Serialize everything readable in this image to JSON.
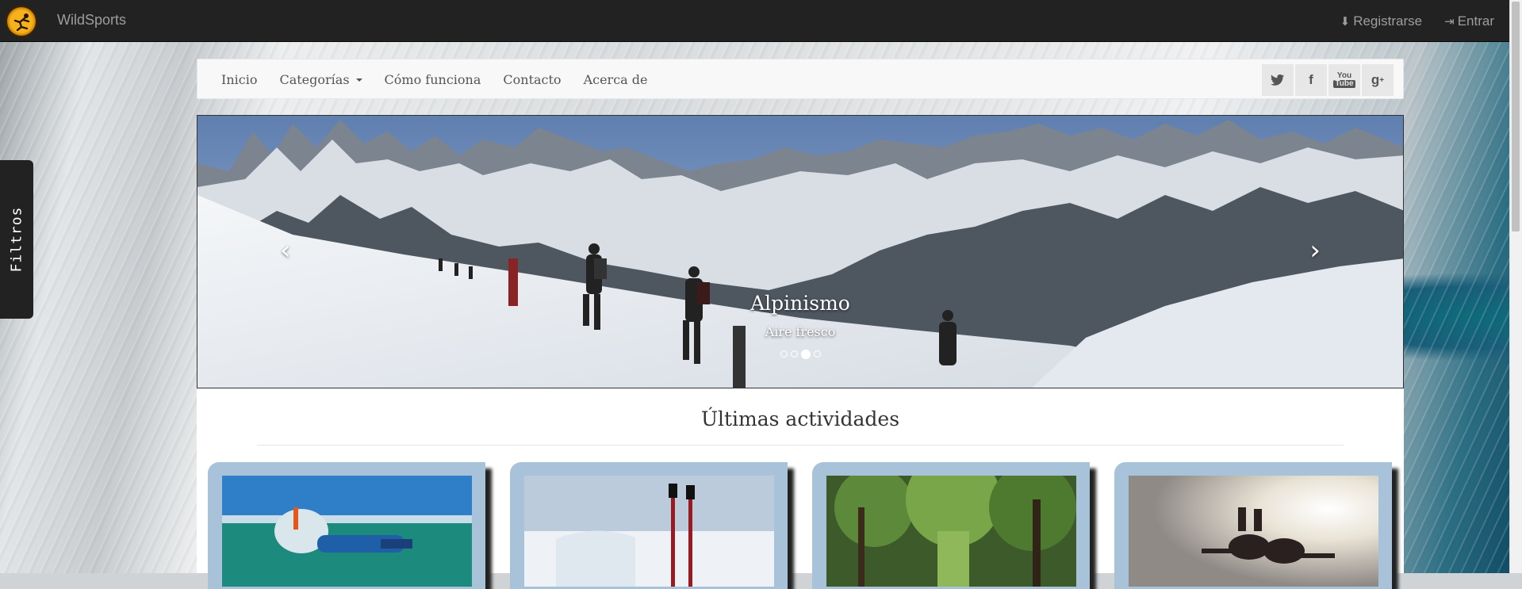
{
  "topbar": {
    "brand": "WildSports",
    "register_label": "Registrarse",
    "login_label": "Entrar"
  },
  "sidebar_tab": {
    "label": "Filtros"
  },
  "subnav": {
    "items": [
      {
        "label": "Inicio"
      },
      {
        "label": "Categorías"
      },
      {
        "label": "Cómo funciona"
      },
      {
        "label": "Contacto"
      },
      {
        "label": "Acerca de"
      }
    ],
    "social": [
      {
        "icon": "twitter-icon",
        "glyph": "🐦"
      },
      {
        "icon": "facebook-icon",
        "glyph": "f"
      },
      {
        "icon": "youtube-icon",
        "glyph": "You\nTube"
      },
      {
        "icon": "google-plus-icon",
        "glyph": "g+"
      }
    ]
  },
  "carousel": {
    "title": "Alpinismo",
    "subtitle": "Aire fresco",
    "slide_count": 4,
    "active_slide": 3
  },
  "section": {
    "title": "Últimas actividades"
  },
  "colors": {
    "navbar": "#222222",
    "card_frame": "#a8c2da"
  }
}
